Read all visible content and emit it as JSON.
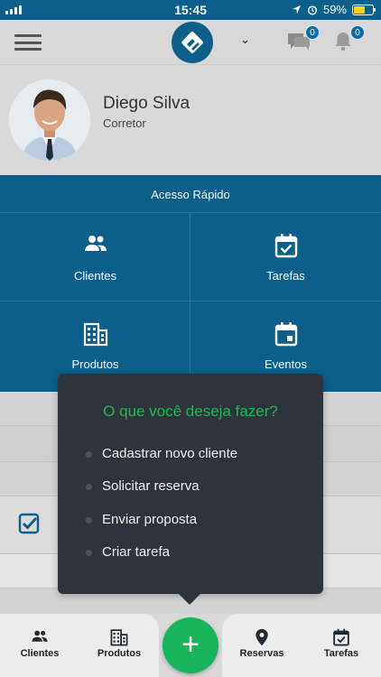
{
  "status_bar": {
    "time": "15:45",
    "battery_percent": "59%",
    "battery_level": 0.59,
    "battery_color": "#ffd60a"
  },
  "header": {
    "messages_badge": "0",
    "notifications_badge": "0",
    "icons": [
      "menu-icon",
      "app-logo",
      "chevron-down-icon",
      "chat-icon",
      "bell-icon"
    ]
  },
  "profile": {
    "name": "Diego Silva",
    "role": "Corretor"
  },
  "quick_access": {
    "title": "Acesso Rápido",
    "items": [
      {
        "label": "Clientes",
        "icon": "people-icon"
      },
      {
        "label": "Tarefas",
        "icon": "calendar-check-icon"
      },
      {
        "label": "Produtos",
        "icon": "building-icon"
      },
      {
        "label": "Eventos",
        "icon": "calendar-icon"
      }
    ]
  },
  "popup": {
    "title": "O que você deseja fazer?",
    "options": [
      "Cadastrar novo cliente",
      "Solicitar reserva",
      "Enviar proposta",
      "Criar tarefa"
    ]
  },
  "bottom_nav": {
    "items": [
      {
        "label": "Clientes",
        "icon": "people-icon"
      },
      {
        "label": "Produtos",
        "icon": "building-icon"
      },
      {
        "label": "Reservas",
        "icon": "location-pin-icon"
      },
      {
        "label": "Tarefas",
        "icon": "calendar-check-icon"
      }
    ],
    "fab_label": "+"
  },
  "colors": {
    "brand_blue": "#0b5f8a",
    "accent_green": "#17b45b",
    "popup_bg": "#2e343b"
  }
}
